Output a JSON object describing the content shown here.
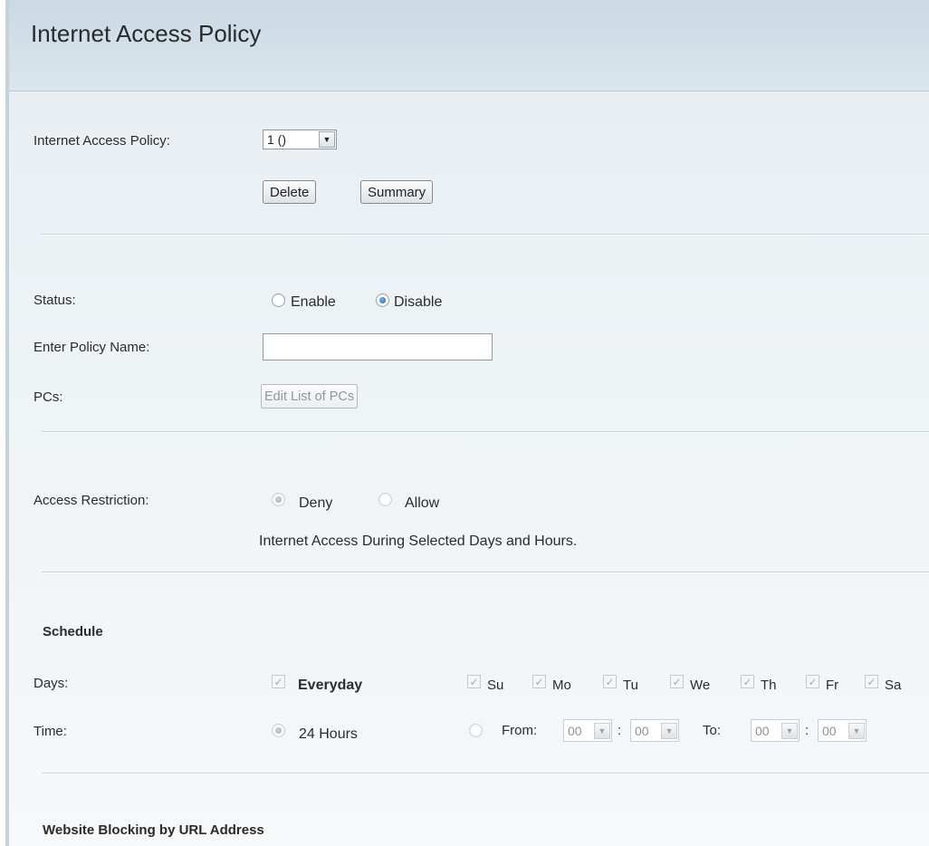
{
  "header": {
    "title": "Internet Access Policy"
  },
  "policy_select": {
    "label": "Internet Access Policy:",
    "value": "1 ()",
    "delete_label": "Delete",
    "summary_label": "Summary"
  },
  "status": {
    "label": "Status:",
    "enable_label": "Enable",
    "disable_label": "Disable",
    "selected": "Disable"
  },
  "policy_name": {
    "label": "Enter Policy Name:",
    "value": ""
  },
  "pcs": {
    "label": "PCs:",
    "button_label": "Edit List of PCs"
  },
  "access_restriction": {
    "label": "Access Restriction:",
    "deny_label": "Deny",
    "allow_label": "Allow",
    "selected": "Deny",
    "note": "Internet Access During Selected Days and Hours."
  },
  "schedule": {
    "heading": "Schedule",
    "days_label": "Days:",
    "everyday_label": "Everyday",
    "days": [
      "Su",
      "Mo",
      "Tu",
      "We",
      "Th",
      "Fr",
      "Sa"
    ],
    "time_label": "Time:",
    "hours24_label": "24 Hours",
    "from_label": "From:",
    "to_label": "To:",
    "colon": ":",
    "from_hour": "00",
    "from_min": "00",
    "to_hour": "00",
    "to_min": "00"
  },
  "website_blocking": {
    "heading": "Website Blocking by URL Address"
  }
}
